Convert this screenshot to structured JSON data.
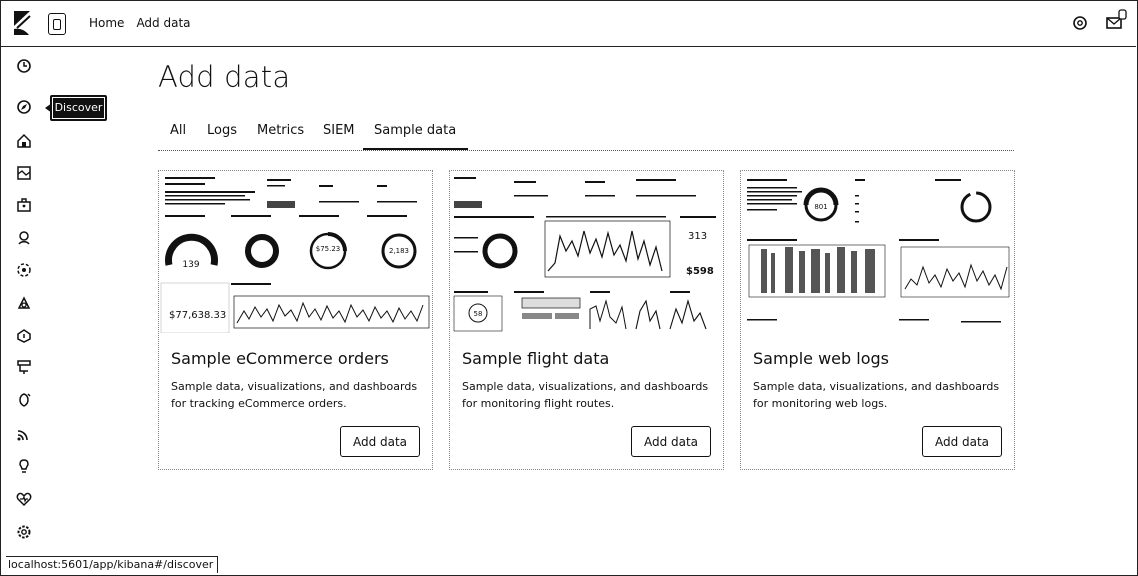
{
  "header": {
    "breadcrumbs": [
      "Home",
      "Add data"
    ]
  },
  "nav": {
    "tooltip": "Discover",
    "icons": [
      "clock-icon",
      "compass-icon",
      "dashboard-icon",
      "canvas-icon",
      "briefcase-icon",
      "maps-icon",
      "ml-icon",
      "graph-icon",
      "apm-icon",
      "uptime-icon",
      "siem-icon",
      "signal-icon",
      "lightbulb-icon",
      "heartbeat-icon",
      "gear-icon"
    ]
  },
  "main": {
    "title": "Add data",
    "tabs": [
      "All",
      "Logs",
      "Metrics",
      "SIEM",
      "Sample data"
    ],
    "active_tab": "Sample data",
    "cards": [
      {
        "title": "Sample eCommerce orders",
        "description": "Sample data, visualizations, and dashboards for tracking eCommerce orders.",
        "button": "Add data",
        "thumb": {
          "gauge": "139",
          "donut_a": "",
          "donut_b": "$75.23",
          "donut_c": "2,183",
          "metric": "$77,638.33"
        }
      },
      {
        "title": "Sample flight data",
        "description": "Sample data, visualizations, and dashboards for monitoring flight routes.",
        "button": "Add data",
        "thumb": {
          "metric_a": "313",
          "metric_b": "$598",
          "small": "58"
        }
      },
      {
        "title": "Sample web logs",
        "description": "Sample data, visualizations, and dashboards for monitoring web logs.",
        "button": "Add data",
        "thumb": {
          "donut": "801"
        }
      }
    ]
  },
  "status_bar": {
    "url": "localhost:5601/app/kibana#/discover"
  }
}
